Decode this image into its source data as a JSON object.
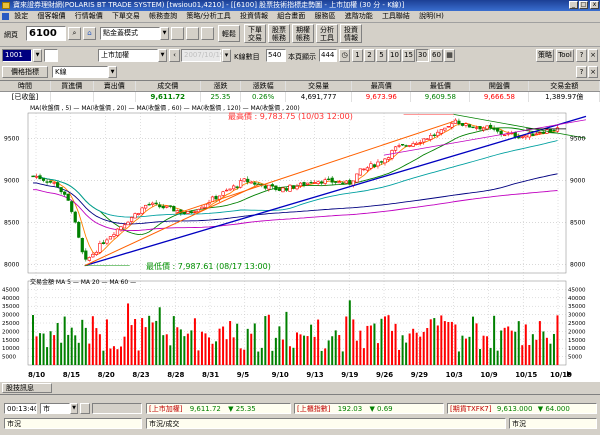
{
  "window": {
    "title": "寶來證券理財網(POLARIS BT TRADE SYSTEM) [twsiou01,4210] - [[6100] 股票技術指標走勢圖 - 上市加權 (30 分 - K線)]",
    "min": "_",
    "max": "□",
    "close": "x"
  },
  "menu": [
    "設定",
    "個客報價",
    "行情報價",
    "下單交易",
    "帳務查詢",
    "策略/分析工具",
    "投資情報",
    "組合畫面",
    "服務區",
    "進階功能",
    "工具聯結",
    "說明(H)"
  ],
  "toolbar": {
    "label": "網頁",
    "code": "6100",
    "layout": "點金蓋模式",
    "buttons": [
      "輕鬆",
      "下單交易",
      "股票帳務",
      "期權帳務",
      "分析工具",
      "投資情報"
    ]
  },
  "chartbar": {
    "symbol": "1001",
    "name": "上市加權",
    "date": "2007/10/19",
    "kcount_label": "K線數目",
    "kcount": "540",
    "visible_label": "本頁顯示",
    "visible": "444",
    "periods": [
      "1",
      "2",
      "5",
      "10",
      "15",
      "30",
      "60"
    ],
    "right_buttons": [
      "策略",
      "Tool"
    ]
  },
  "indicator_bar": {
    "label": "價格指標",
    "type": "K線"
  },
  "quote_table": {
    "headers": [
      "時間",
      "買進價",
      "賣出價",
      "成交價",
      "漲跌",
      "漲跌幅",
      "交易量",
      "最高價",
      "最低價",
      "開盤價",
      "交易金額"
    ],
    "values": [
      "[已收盤]",
      "",
      "",
      "9,611.72",
      "25.35",
      "0.26%",
      "4,691,777",
      "9,673.96",
      "9,609.58",
      "9,666.58",
      "1,389.97億"
    ]
  },
  "chart_data": {
    "type": "candlestick",
    "price_panel": {
      "legend": "MA(收盤價 , 5) — MA(收盤價 , 20) — MA(收盤價 , 60) — MA(收盤價 , 120) — MA(收盤價 , 200)",
      "ylim": [
        7900,
        9800
      ],
      "yticks": [
        8000,
        8500,
        9000,
        9500
      ],
      "high_label": "最高價 : 9,783.75 (10/03 12:00)",
      "low_label": "最低價 : 7,987.61 (08/17 13:00)",
      "high": 9783.75,
      "low": 7987.61
    },
    "volume_panel": {
      "legend": "交易金額  MA  5 — MA  20 — MA  60 —",
      "ylim": [
        0,
        50000
      ],
      "yticks": [
        5000,
        10000,
        15000,
        20000,
        25000,
        30000,
        35000,
        40000,
        45000
      ]
    },
    "x_ticks": [
      "8/10",
      "8/15",
      "8/20",
      "8/23",
      "8/28",
      "8/31",
      "9/5",
      "9/10",
      "9/13",
      "9/19",
      "9/26",
      "9/29",
      "10/3",
      "10/9",
      "10/15",
      "10/19"
    ],
    "close_path": [
      [
        "8/10",
        9050
      ],
      [
        "8/13",
        8950
      ],
      [
        "8/15",
        8700
      ],
      [
        "8/16",
        8350
      ],
      [
        "8/17",
        8020
      ],
      [
        "8/20",
        8300
      ],
      [
        "8/21",
        8420
      ],
      [
        "8/23",
        8650
      ],
      [
        "8/24",
        8720
      ],
      [
        "8/28",
        8650
      ],
      [
        "8/29",
        8600
      ],
      [
        "8/31",
        8760
      ],
      [
        "9/3",
        8900
      ],
      [
        "9/5",
        9000
      ],
      [
        "9/7",
        8950
      ],
      [
        "9/10",
        8890
      ],
      [
        "9/12",
        8950
      ],
      [
        "9/13",
        9000
      ],
      [
        "9/17",
        8980
      ],
      [
        "9/19",
        8960
      ],
      [
        "9/21",
        9100
      ],
      [
        "9/26",
        9250
      ],
      [
        "9/27",
        9380
      ],
      [
        "9/29",
        9470
      ],
      [
        "10/2",
        9600
      ],
      [
        "10/3",
        9730
      ],
      [
        "10/5",
        9650
      ],
      [
        "10/9",
        9620
      ],
      [
        "10/11",
        9560
      ],
      [
        "10/15",
        9520
      ],
      [
        "10/17",
        9580
      ],
      [
        "10/19",
        9611.72
      ]
    ]
  },
  "bottom": {
    "tab": "股技訊息",
    "time": "00:13:40",
    "market": "市",
    "quotes": [
      {
        "label": "[上市加權]",
        "value": "9,611.72",
        "change": "▼ 25.35"
      },
      {
        "label": "[上櫃指數]",
        "value": "192.03",
        "change": "▼ 0.69"
      },
      {
        "label": "[期貨TXFK7]",
        "value": "9,613.000",
        "change": "▼ 64.000"
      }
    ],
    "row2_left": "市況",
    "row2_mid": "市況/成交",
    "row2_right": "市況"
  },
  "colors": {
    "candle_up": "#ff0000",
    "candle_down": "#008000",
    "ma5": "#ff8000",
    "ma20": "#008000",
    "ma60": "#00a0a0",
    "ma120": "#000080",
    "ma200": "#c000c0",
    "trend": "#0000c0"
  }
}
